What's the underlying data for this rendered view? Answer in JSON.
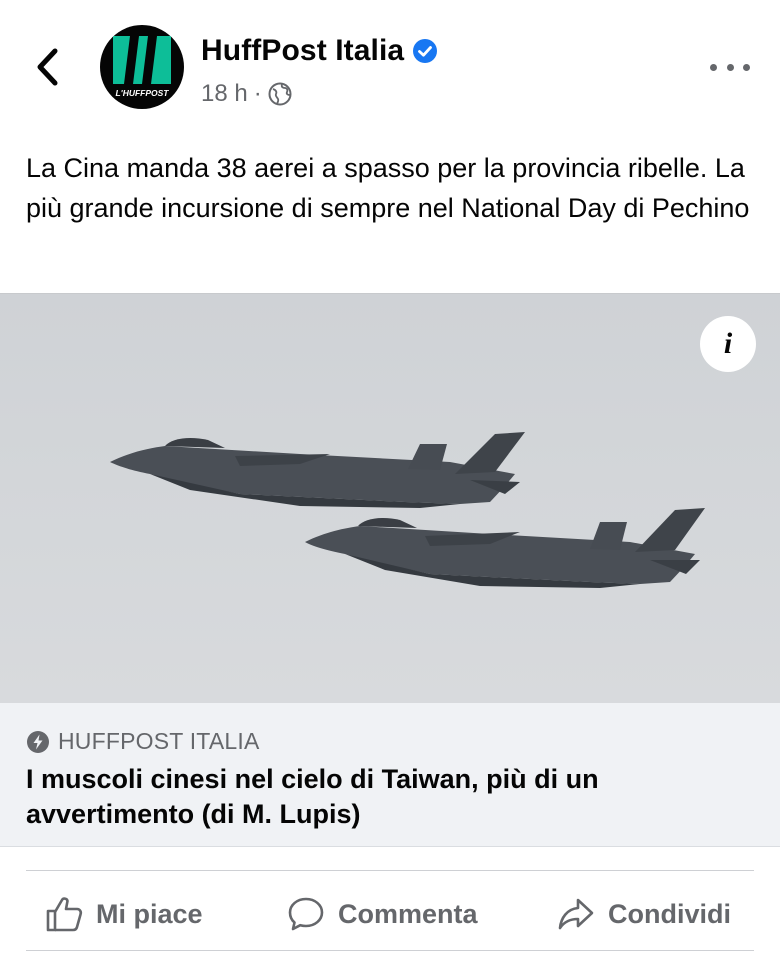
{
  "header": {
    "page_name": "HuffPost Italia",
    "verified": true,
    "timestamp": "18 h",
    "separator": "·",
    "privacy_icon": "globe-icon",
    "back_icon": "chevron-left-icon",
    "more_icon": "more-horizontal-icon"
  },
  "avatar": {
    "logo_text": "L'HUFFPOST",
    "brand_color": "#0dbe98"
  },
  "post": {
    "text": "La Cina manda 38 aerei a spasso per la provincia ribelle. La più grande incursione di sempre nel National Day di Pechino"
  },
  "photo": {
    "info_label": "i"
  },
  "link": {
    "source": "HUFFPOST ITALIA",
    "source_icon": "bolt-icon",
    "title": "I muscoli cinesi nel cielo di Taiwan, più di un avvertimento (di M. Lupis)"
  },
  "actions": [
    {
      "label": "Mi piace",
      "icon": "thumbs-up-icon"
    },
    {
      "label": "Commenta",
      "icon": "comment-icon"
    },
    {
      "label": "Condividi",
      "icon": "share-icon"
    }
  ],
  "colors": {
    "text_primary": "#050505",
    "text_secondary": "#65676b",
    "verified_blue": "#1877f2",
    "card_bg": "#f0f2f5"
  }
}
